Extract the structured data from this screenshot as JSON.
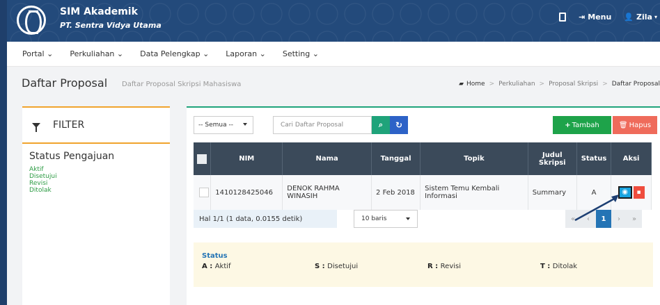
{
  "header": {
    "app_title": "SIM Akademik",
    "app_subtitle": "PT. Sentra Vidya Utama",
    "menu_label": "Menu",
    "user_label": "Zila"
  },
  "nav": [
    "Portal",
    "Perkuliahan",
    "Data Pelengkap",
    "Laporan",
    "Setting"
  ],
  "page": {
    "title": "Daftar Proposal",
    "subtitle": "Daftar Proposal Skripsi Mahasiswa",
    "breadcrumb": [
      "Home",
      "Perkuliahan",
      "Proposal Skripsi",
      "Daftar Proposal"
    ]
  },
  "filter": {
    "title": "FILTER",
    "status_title": "Status Pengajuan",
    "items": [
      "Aktif",
      "Disetujui",
      "Revisi",
      "Ditolak"
    ]
  },
  "toolbar": {
    "select_value": "-- Semua --",
    "search_placeholder": "Cari Daftar Proposal",
    "add_label": "Tambah",
    "delete_label": "Hapus"
  },
  "table": {
    "columns": [
      "NIM",
      "Nama",
      "Tanggal",
      "Topik",
      "Judul Skripsi",
      "Status",
      "Aksi"
    ],
    "rows": [
      [
        "1410128425046",
        "DENOK RAHMA WINASIH",
        "2 Feb 2018",
        "Sistem Temu Kembali Informasi",
        "Summary",
        "A"
      ]
    ]
  },
  "pagination": {
    "info": "Hal 1/1 (1 data, 0.0155 detik)",
    "rows_label": "10 baris",
    "current_page": "1"
  },
  "legend": {
    "title": "Status",
    "items": [
      {
        "code": "A",
        "label": "Aktif"
      },
      {
        "code": "S",
        "label": "Disetujui"
      },
      {
        "code": "R",
        "label": "Revisi"
      },
      {
        "code": "T",
        "label": "Ditolak"
      }
    ]
  },
  "colors": {
    "header": "#234a7b",
    "accent_filter": "#f0a32c",
    "accent_main": "#1fa37a",
    "table_head": "#3b4a5a"
  }
}
